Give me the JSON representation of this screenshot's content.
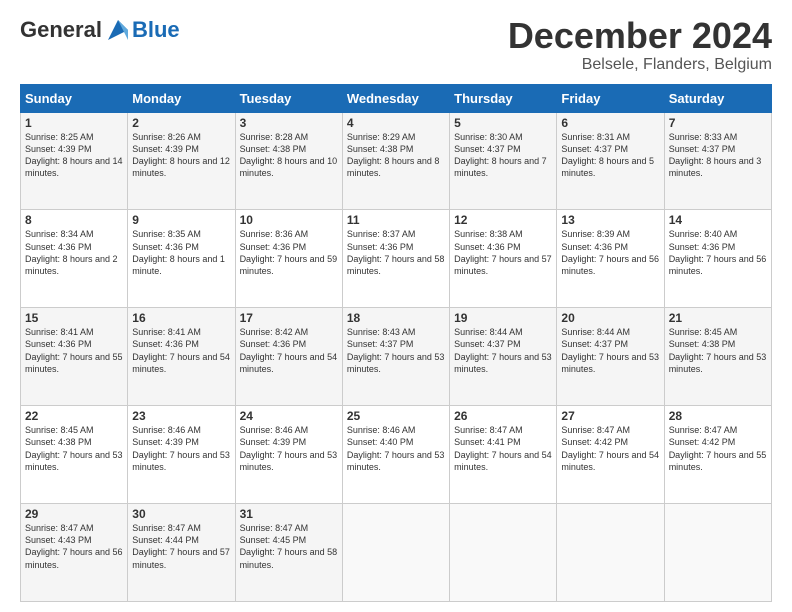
{
  "header": {
    "logo_general": "General",
    "logo_blue": "Blue",
    "month": "December 2024",
    "location": "Belsele, Flanders, Belgium"
  },
  "days_of_week": [
    "Sunday",
    "Monday",
    "Tuesday",
    "Wednesday",
    "Thursday",
    "Friday",
    "Saturday"
  ],
  "weeks": [
    [
      {
        "day": "1",
        "sunrise": "Sunrise: 8:25 AM",
        "sunset": "Sunset: 4:39 PM",
        "daylight": "Daylight: 8 hours and 14 minutes."
      },
      {
        "day": "2",
        "sunrise": "Sunrise: 8:26 AM",
        "sunset": "Sunset: 4:39 PM",
        "daylight": "Daylight: 8 hours and 12 minutes."
      },
      {
        "day": "3",
        "sunrise": "Sunrise: 8:28 AM",
        "sunset": "Sunset: 4:38 PM",
        "daylight": "Daylight: 8 hours and 10 minutes."
      },
      {
        "day": "4",
        "sunrise": "Sunrise: 8:29 AM",
        "sunset": "Sunset: 4:38 PM",
        "daylight": "Daylight: 8 hours and 8 minutes."
      },
      {
        "day": "5",
        "sunrise": "Sunrise: 8:30 AM",
        "sunset": "Sunset: 4:37 PM",
        "daylight": "Daylight: 8 hours and 7 minutes."
      },
      {
        "day": "6",
        "sunrise": "Sunrise: 8:31 AM",
        "sunset": "Sunset: 4:37 PM",
        "daylight": "Daylight: 8 hours and 5 minutes."
      },
      {
        "day": "7",
        "sunrise": "Sunrise: 8:33 AM",
        "sunset": "Sunset: 4:37 PM",
        "daylight": "Daylight: 8 hours and 3 minutes."
      }
    ],
    [
      {
        "day": "8",
        "sunrise": "Sunrise: 8:34 AM",
        "sunset": "Sunset: 4:36 PM",
        "daylight": "Daylight: 8 hours and 2 minutes."
      },
      {
        "day": "9",
        "sunrise": "Sunrise: 8:35 AM",
        "sunset": "Sunset: 4:36 PM",
        "daylight": "Daylight: 8 hours and 1 minute."
      },
      {
        "day": "10",
        "sunrise": "Sunrise: 8:36 AM",
        "sunset": "Sunset: 4:36 PM",
        "daylight": "Daylight: 7 hours and 59 minutes."
      },
      {
        "day": "11",
        "sunrise": "Sunrise: 8:37 AM",
        "sunset": "Sunset: 4:36 PM",
        "daylight": "Daylight: 7 hours and 58 minutes."
      },
      {
        "day": "12",
        "sunrise": "Sunrise: 8:38 AM",
        "sunset": "Sunset: 4:36 PM",
        "daylight": "Daylight: 7 hours and 57 minutes."
      },
      {
        "day": "13",
        "sunrise": "Sunrise: 8:39 AM",
        "sunset": "Sunset: 4:36 PM",
        "daylight": "Daylight: 7 hours and 56 minutes."
      },
      {
        "day": "14",
        "sunrise": "Sunrise: 8:40 AM",
        "sunset": "Sunset: 4:36 PM",
        "daylight": "Daylight: 7 hours and 56 minutes."
      }
    ],
    [
      {
        "day": "15",
        "sunrise": "Sunrise: 8:41 AM",
        "sunset": "Sunset: 4:36 PM",
        "daylight": "Daylight: 7 hours and 55 minutes."
      },
      {
        "day": "16",
        "sunrise": "Sunrise: 8:41 AM",
        "sunset": "Sunset: 4:36 PM",
        "daylight": "Daylight: 7 hours and 54 minutes."
      },
      {
        "day": "17",
        "sunrise": "Sunrise: 8:42 AM",
        "sunset": "Sunset: 4:36 PM",
        "daylight": "Daylight: 7 hours and 54 minutes."
      },
      {
        "day": "18",
        "sunrise": "Sunrise: 8:43 AM",
        "sunset": "Sunset: 4:37 PM",
        "daylight": "Daylight: 7 hours and 53 minutes."
      },
      {
        "day": "19",
        "sunrise": "Sunrise: 8:44 AM",
        "sunset": "Sunset: 4:37 PM",
        "daylight": "Daylight: 7 hours and 53 minutes."
      },
      {
        "day": "20",
        "sunrise": "Sunrise: 8:44 AM",
        "sunset": "Sunset: 4:37 PM",
        "daylight": "Daylight: 7 hours and 53 minutes."
      },
      {
        "day": "21",
        "sunrise": "Sunrise: 8:45 AM",
        "sunset": "Sunset: 4:38 PM",
        "daylight": "Daylight: 7 hours and 53 minutes."
      }
    ],
    [
      {
        "day": "22",
        "sunrise": "Sunrise: 8:45 AM",
        "sunset": "Sunset: 4:38 PM",
        "daylight": "Daylight: 7 hours and 53 minutes."
      },
      {
        "day": "23",
        "sunrise": "Sunrise: 8:46 AM",
        "sunset": "Sunset: 4:39 PM",
        "daylight": "Daylight: 7 hours and 53 minutes."
      },
      {
        "day": "24",
        "sunrise": "Sunrise: 8:46 AM",
        "sunset": "Sunset: 4:39 PM",
        "daylight": "Daylight: 7 hours and 53 minutes."
      },
      {
        "day": "25",
        "sunrise": "Sunrise: 8:46 AM",
        "sunset": "Sunset: 4:40 PM",
        "daylight": "Daylight: 7 hours and 53 minutes."
      },
      {
        "day": "26",
        "sunrise": "Sunrise: 8:47 AM",
        "sunset": "Sunset: 4:41 PM",
        "daylight": "Daylight: 7 hours and 54 minutes."
      },
      {
        "day": "27",
        "sunrise": "Sunrise: 8:47 AM",
        "sunset": "Sunset: 4:42 PM",
        "daylight": "Daylight: 7 hours and 54 minutes."
      },
      {
        "day": "28",
        "sunrise": "Sunrise: 8:47 AM",
        "sunset": "Sunset: 4:42 PM",
        "daylight": "Daylight: 7 hours and 55 minutes."
      }
    ],
    [
      {
        "day": "29",
        "sunrise": "Sunrise: 8:47 AM",
        "sunset": "Sunset: 4:43 PM",
        "daylight": "Daylight: 7 hours and 56 minutes."
      },
      {
        "day": "30",
        "sunrise": "Sunrise: 8:47 AM",
        "sunset": "Sunset: 4:44 PM",
        "daylight": "Daylight: 7 hours and 57 minutes."
      },
      {
        "day": "31",
        "sunrise": "Sunrise: 8:47 AM",
        "sunset": "Sunset: 4:45 PM",
        "daylight": "Daylight: 7 hours and 58 minutes."
      },
      null,
      null,
      null,
      null
    ]
  ]
}
